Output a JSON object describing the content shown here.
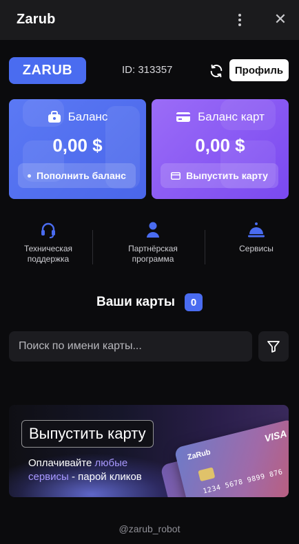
{
  "window": {
    "title": "Zarub"
  },
  "header": {
    "logo": "ZARUB",
    "user_id": "ID: 313357",
    "profile_label": "Профиль"
  },
  "balance_card": {
    "title": "Баланс",
    "amount": "0,00 $",
    "action": "Пополнить баланс"
  },
  "cards_card": {
    "title": "Баланс карт",
    "amount": "0,00 $",
    "action": "Выпустить карту"
  },
  "quick_actions": [
    {
      "label_line1": "Техническая",
      "label_line2": "поддержка",
      "icon": "headset-icon"
    },
    {
      "label_line1": "Партнёрская",
      "label_line2": "программа",
      "icon": "user-icon"
    },
    {
      "label_line1": "Сервисы",
      "label_line2": "",
      "icon": "service-bell-icon"
    }
  ],
  "cards_section": {
    "title": "Ваши карты",
    "count": "0"
  },
  "search": {
    "placeholder": "Поиск по имени карты...",
    "value": ""
  },
  "banner": {
    "cta": "Выпустить карту",
    "line1_a": "Оплачивайте ",
    "line1_b": "любые",
    "line2_a": "сервисы",
    "line2_b": " - парой кликов",
    "card_brand": "ZaRub",
    "card_network": "VISA",
    "card_number": "1234 5678 9899 876"
  },
  "footer": {
    "text": "@zarub_robot"
  },
  "colors": {
    "accent_blue": "#4a6cf0",
    "balance_card": "#5273f2",
    "cards_card": "#8a5af4",
    "background": "#0b0b0d",
    "titlebar": "#1b1b1d",
    "highlight_text": "#a898ff"
  }
}
